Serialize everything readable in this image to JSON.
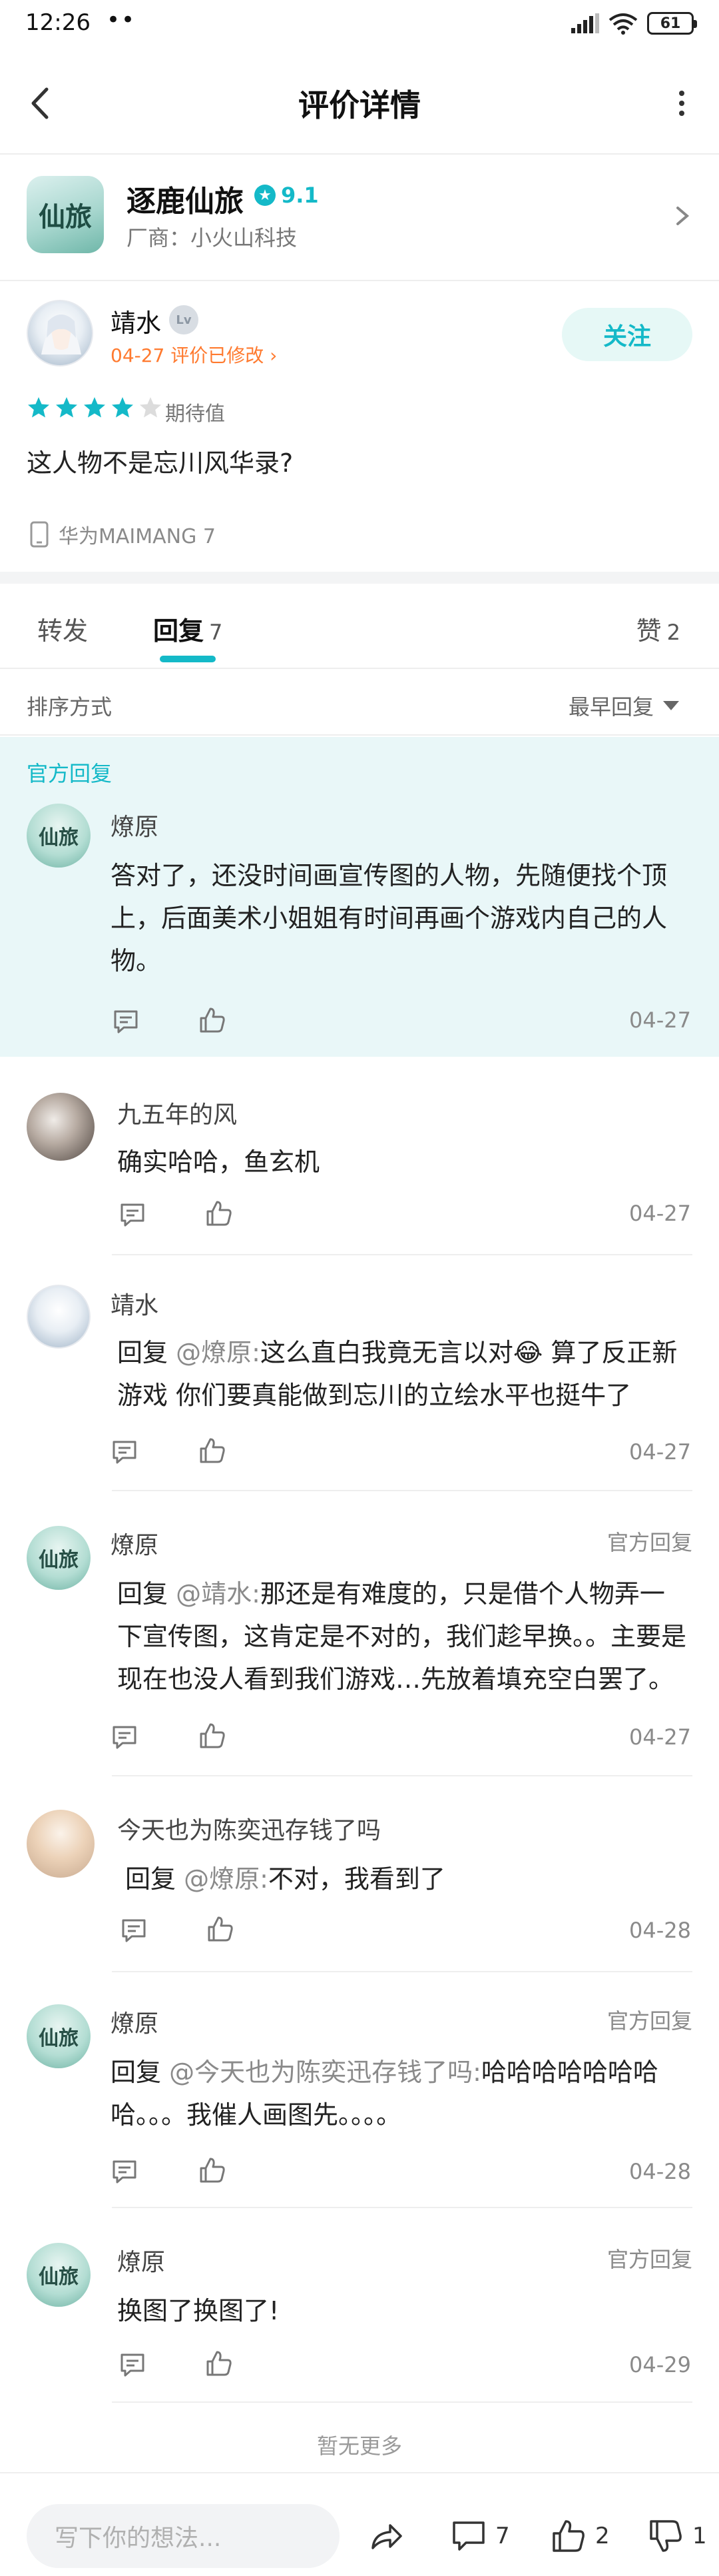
{
  "status": {
    "time": "12:26",
    "dots": "••",
    "battery": "61"
  },
  "header": {
    "title": "评价详情"
  },
  "game": {
    "name": "逐鹿仙旅",
    "score": "9.1",
    "vendor": "厂商：小火山科技",
    "icon_text": "仙旅"
  },
  "review": {
    "author": "靖水",
    "level": "Lv",
    "date_meta": "04-27 评价已修改",
    "follow_label": "关注",
    "stars": 4,
    "max_stars": 5,
    "rating_label": "期待值",
    "text": "这人物不是忘川风华录?",
    "device": "华为MAIMANG 7"
  },
  "tabs": {
    "forward": "转发",
    "reply": "回复",
    "reply_count": "7",
    "like": "赞",
    "like_count": "2"
  },
  "sort": {
    "label": "排序方式",
    "value": "最早回复"
  },
  "official_label": "官方回复",
  "replies": [
    {
      "name": "燎原",
      "text": "答对了，还没时间画宣传图的人物，先随便找个顶上，后面美术小姐姐有时间再画个游戏内自己的人物。",
      "date": "04-27"
    },
    {
      "name": "九五年的风",
      "text": "确实哈哈，鱼玄机",
      "date": "04-27"
    },
    {
      "name": "靖水",
      "prefix": "回复 ",
      "mention": "@燎原:",
      "text": "这么直白我竟无言以对😂 算了反正新游戏 你们要真能做到忘川的立绘水平也挺牛了",
      "date": "04-27"
    },
    {
      "name": "燎原",
      "tag": "官方回复",
      "prefix": "回复 ",
      "mention": "@靖水:",
      "text": "那还是有难度的，只是借个人物弄一下宣传图，这肯定是不对的，我们趁早换。。主要是现在也没人看到我们游戏…先放着填充空白罢了。",
      "date": "04-27"
    },
    {
      "name": "今天也为陈奕迅存钱了吗",
      "prefix": "回复 ",
      "mention": "@燎原:",
      "text": "不对，我看到了",
      "date": "04-28"
    },
    {
      "name": "燎原",
      "tag": "官方回复",
      "prefix": "回复 ",
      "mention": "@今天也为陈奕迅存钱了吗:",
      "text": "哈哈哈哈哈哈哈哈。。。我催人画图先。。。。",
      "date": "04-28"
    },
    {
      "name": "燎原",
      "tag": "官方回复",
      "text": "换图了换图了!",
      "date": "04-29"
    }
  ],
  "no_more": "暂无更多",
  "bottom": {
    "placeholder": "写下你的想法...",
    "comment_count": "7",
    "like_count": "2",
    "dislike_count": "1"
  },
  "colors": {
    "accent": "#14b9c8",
    "orange": "#ff7a2f",
    "star": "#14b9c8"
  }
}
